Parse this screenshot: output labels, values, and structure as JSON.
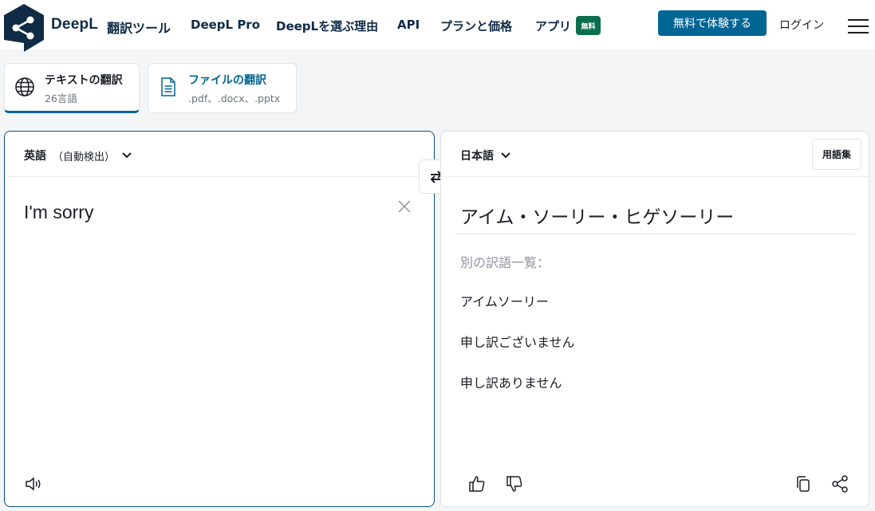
{
  "header": {
    "brand": "DeepL",
    "brand_sub": "翻訳ツール",
    "nav": [
      "DeepL Pro",
      "DeepLを選ぶ理由",
      "API",
      "プランと価格",
      "アプリ"
    ],
    "badge": "無料",
    "cta": "無料で体験する",
    "login": "ログイン"
  },
  "tabs": [
    {
      "title": "テキストの翻訳",
      "sub": "26言語"
    },
    {
      "title": "ファイルの翻訳",
      "sub": ".pdf、.docx、.pptx"
    }
  ],
  "source": {
    "lang": "英語",
    "auto": "（自動検出）",
    "text": "I'm sorry"
  },
  "target": {
    "lang": "日本語",
    "glossary": "用語集",
    "text": "アイム・ソーリー・ヒゲソーリー",
    "alt_heading": "別の訳語一覧：",
    "alternatives": [
      "アイムソーリー",
      "申し訳ございません",
      "申し訳ありません"
    ]
  },
  "colors": {
    "brand_dark": "#0f2b46",
    "accent": "#006494",
    "badge_green": "#0b6e4f"
  }
}
